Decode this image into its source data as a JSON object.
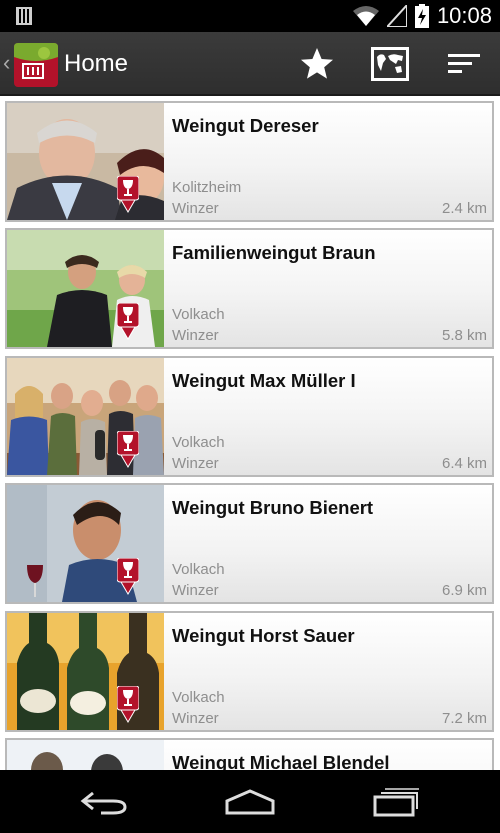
{
  "status_bar": {
    "time": "10:08",
    "icons": [
      "notification-icon",
      "wifi-icon",
      "signal-icon",
      "battery-charging-icon"
    ]
  },
  "action_bar": {
    "title": "Home",
    "actions": [
      "favorites-star-icon",
      "map-icon",
      "sort-filter-icon"
    ]
  },
  "colors": {
    "action_bar": "#333333",
    "card_border": "#b9b9b9",
    "pin": "#b3122a",
    "secondary_text": "#8e8e8e"
  },
  "wineries": [
    {
      "name": "Weingut Dereser",
      "place": "Kolitzheim",
      "type": "Winzer",
      "distance": "2.4 km"
    },
    {
      "name": "Familienweingut Braun",
      "place": "Volkach",
      "type": "Winzer",
      "distance": "5.8 km"
    },
    {
      "name": "Weingut Max Müller I",
      "place": "Volkach",
      "type": "Winzer",
      "distance": "6.4 km"
    },
    {
      "name": "Weingut Bruno Bienert",
      "place": "Volkach",
      "type": "Winzer",
      "distance": "6.9 km"
    },
    {
      "name": "Weingut Horst Sauer",
      "place": "Volkach",
      "type": "Winzer",
      "distance": "7.2 km"
    },
    {
      "name": "Weingut Michael Blendel"
    }
  ],
  "nav_bar": {
    "buttons": [
      "back-icon",
      "home-icon",
      "recent-apps-icon"
    ]
  }
}
